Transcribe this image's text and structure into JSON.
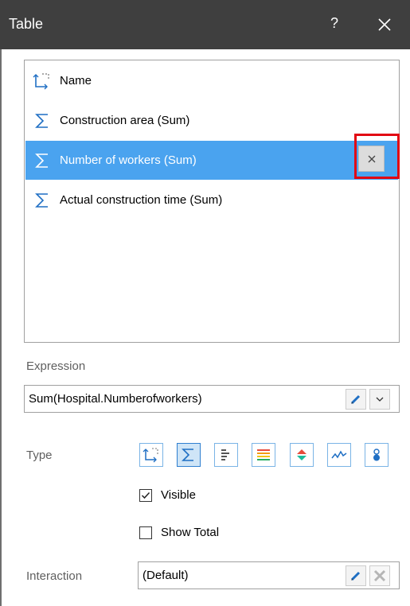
{
  "window": {
    "title": "Table",
    "help_label": "?"
  },
  "icons": {
    "dimension": "dimension-icon",
    "measure": "sigma-icon",
    "close": "close-icon",
    "edit": "pencil-icon",
    "dropdown": "chevron-down-icon"
  },
  "fields": [
    {
      "label": "Name",
      "icon": "dimension-icon",
      "selected": false
    },
    {
      "label": "Construction area (Sum)",
      "icon": "sigma-icon",
      "selected": false
    },
    {
      "label": "Number of workers (Sum)",
      "icon": "sigma-icon",
      "selected": true
    },
    {
      "label": "Actual construction time (Sum)",
      "icon": "sigma-icon",
      "selected": false
    }
  ],
  "expression": {
    "label": "Expression",
    "value": "Sum(Hospital.Numberofworkers)"
  },
  "type": {
    "label": "Type",
    "options": [
      "dimension-icon",
      "sigma-icon",
      "bars-icon",
      "color-bars-icon",
      "indicator-icon",
      "sparkline-icon",
      "bubble-icon"
    ],
    "selected": "sigma-icon"
  },
  "options": {
    "visible_label": "Visible",
    "visible_checked": true,
    "show_total_label": "Show Total",
    "show_total_checked": false
  },
  "interaction": {
    "label": "Interaction",
    "value": "(Default)"
  },
  "colors": {
    "title_bar": "#3f3f3f",
    "selection": "#4aa3ef",
    "highlight_box": "#e20613",
    "accent_blue": "#2f7fd0"
  }
}
